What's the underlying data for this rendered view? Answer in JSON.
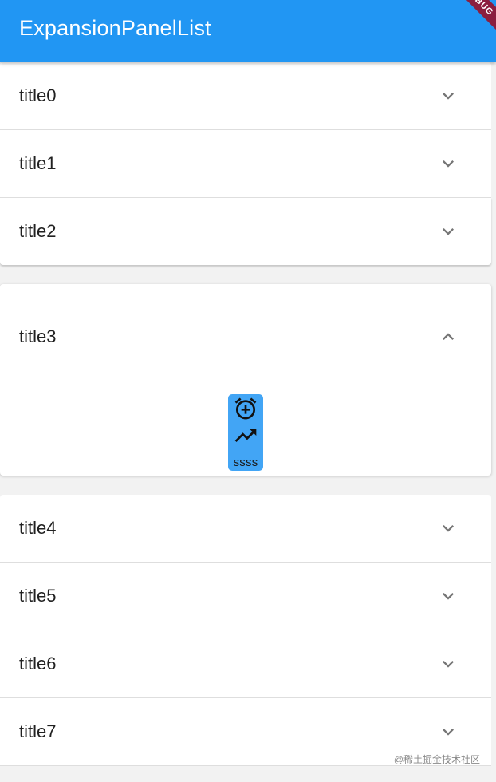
{
  "appbar": {
    "title": "ExpansionPanelList",
    "debug_banner": "DEBUG"
  },
  "panels": [
    {
      "title": "title0",
      "expanded": false,
      "icon": "chevron-down-icon"
    },
    {
      "title": "title1",
      "expanded": false,
      "icon": "chevron-down-icon"
    },
    {
      "title": "title2",
      "expanded": false,
      "icon": "chevron-down-icon"
    },
    {
      "title": "title3",
      "expanded": true,
      "icon": "chevron-up-icon"
    },
    {
      "title": "title4",
      "expanded": false,
      "icon": "chevron-down-icon"
    },
    {
      "title": "title5",
      "expanded": false,
      "icon": "chevron-down-icon"
    },
    {
      "title": "title6",
      "expanded": false,
      "icon": "chevron-down-icon"
    },
    {
      "title": "title7",
      "expanded": false,
      "icon": "chevron-down-icon"
    }
  ],
  "expanded_body": {
    "icons": [
      "alarm-add-icon",
      "trending-up-icon"
    ],
    "label": "ssss",
    "background": "#42a5f5"
  },
  "colors": {
    "appbar": "#2196f3",
    "debug_banner": "#8b1e3f"
  },
  "watermark": "@稀土掘金技术社区"
}
